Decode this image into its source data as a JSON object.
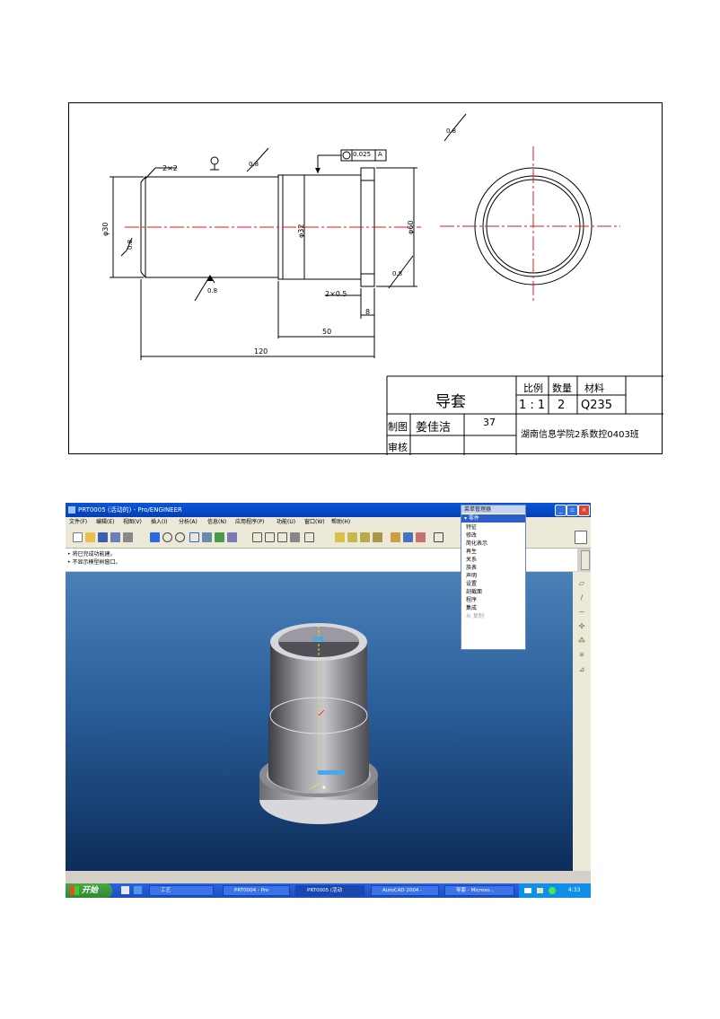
{
  "drawing": {
    "dims": {
      "chamfer_left": "2×2",
      "dia_30": "φ30",
      "dia_32": "φ32",
      "dia_60": "φ60",
      "chamfer_flange": "2×0.5",
      "len_8": "8",
      "len_50": "50",
      "len_120": "120",
      "roughness": "0.8",
      "tolerance_value": "0.025",
      "datum": "A",
      "datum_symbol": "♀"
    },
    "title_block": {
      "part_name": "导套",
      "scale_label": "比例",
      "qty_label": "数量",
      "material_label": "材料",
      "scale": "1 : 1",
      "qty": "2",
      "material": "Q235",
      "drawn_label": "制图",
      "drawn_by": "姜佳洁",
      "drawn_no": "37",
      "school": "湖南信息学院2系数控0403班",
      "check_label": "审核"
    }
  },
  "app": {
    "window_title": "PRT0005 (活动的) - Pro/ENGINEER",
    "menu": [
      "文件(F)",
      "编辑(E)",
      "视图(V)",
      "插入(I)",
      "分析(A)",
      "信息(N)",
      "应用程序(P)",
      "功能(U)",
      "窗口(W)",
      "帮助(H)"
    ],
    "messages": [
      "• 将已完成功能建。",
      "• 不显示模型树窗口。"
    ],
    "popup": {
      "title": "菜单管理器",
      "section": "零件",
      "items": [
        "特征",
        "修改",
        "简化表示",
        "再生",
        "关系",
        "族表",
        "声明",
        "设置",
        "剖截面",
        "程序",
        "集成"
      ],
      "disabled_item": "从   复制"
    },
    "taskbar": {
      "start": "开始",
      "quick": "工艺",
      "tasks": [
        "PRT0004 - Pro",
        "PRT0005 (活动",
        "AutoCAD 2004 -",
        "导套 - Microso..."
      ],
      "time": "4:33"
    }
  },
  "colors": {
    "centerline": "#e8141c",
    "title_blue": "#0a56d8",
    "viewport_top": "#4a80b8",
    "viewport_bottom": "#0c2d5a"
  }
}
